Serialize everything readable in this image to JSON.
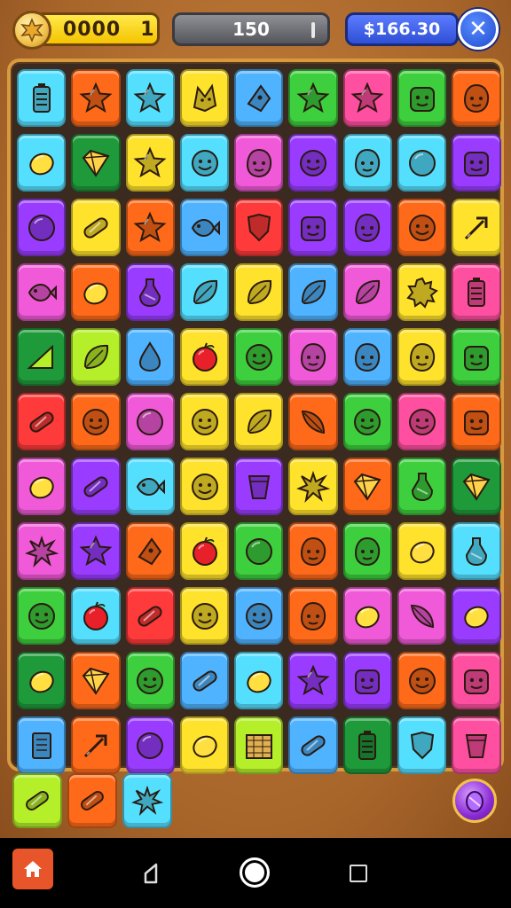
{
  "hud": {
    "coins": "0000",
    "level": "1",
    "score": "150",
    "money": "$166.30",
    "close_symbol": "✕"
  },
  "colors": {
    "blue": "#4fb3ff",
    "orange": "#ff6a1a",
    "yellow": "#ffe22b",
    "red": "#ff3a3a",
    "pink": "#ff4fa0",
    "green": "#3ecf3e",
    "purple": "#9a3cff",
    "lime": "#b4ef2a",
    "cyan": "#55dfff",
    "magenta": "#f05ad8",
    "teal": "#28c6b4",
    "darkgreen": "#1e9a3a"
  },
  "board": [
    [
      [
        "cyan",
        "battery-icon"
      ],
      [
        "orange",
        "star-icon"
      ],
      [
        "cyan",
        "star-icon"
      ],
      [
        "yellow",
        "fox-icon"
      ],
      [
        "blue",
        "cheese-icon"
      ],
      [
        "green",
        "star-icon"
      ],
      [
        "pink",
        "star-icon"
      ],
      [
        "green",
        "robot-face-icon"
      ],
      [
        "orange",
        "blob-icon"
      ]
    ],
    [
      [
        "cyan",
        "lemon-icon"
      ],
      [
        "darkgreen",
        "gem-icon"
      ],
      [
        "yellow",
        "star-icon"
      ],
      [
        "cyan",
        "smile-face-icon"
      ],
      [
        "magenta",
        "blob-icon"
      ],
      [
        "purple",
        "smile-face-icon"
      ],
      [
        "cyan",
        "blob-icon"
      ],
      [
        "cyan",
        "ball-icon"
      ],
      [
        "purple",
        "robot-face-icon"
      ]
    ],
    [
      [
        "purple",
        "ball-icon"
      ],
      [
        "yellow",
        "candy-icon"
      ],
      [
        "orange",
        "star-icon"
      ],
      [
        "blue",
        "fish-icon"
      ],
      [
        "red",
        "shield-icon"
      ],
      [
        "purple",
        "robot-face-icon"
      ],
      [
        "purple",
        "blob-icon"
      ],
      [
        "orange",
        "smile-face-icon"
      ],
      [
        "yellow",
        "arrow-icon"
      ]
    ],
    [
      [
        "magenta",
        "fish-icon"
      ],
      [
        "orange",
        "lemon-icon"
      ],
      [
        "purple",
        "potion-icon"
      ],
      [
        "cyan",
        "leaf-icon"
      ],
      [
        "yellow",
        "leaf-icon"
      ],
      [
        "blue",
        "leaf-icon"
      ],
      [
        "magenta",
        "leaf-icon"
      ],
      [
        "yellow",
        "sun-icon"
      ],
      [
        "pink",
        "battery-icon"
      ]
    ],
    [
      [
        "darkgreen",
        "triangle-icon"
      ],
      [
        "lime",
        "leaf-icon"
      ],
      [
        "blue",
        "drop-icon"
      ],
      [
        "yellow",
        "apple-icon"
      ],
      [
        "green",
        "smile-face-icon"
      ],
      [
        "magenta",
        "blob-icon"
      ],
      [
        "blue",
        "blob-icon"
      ],
      [
        "yellow",
        "blob-icon"
      ],
      [
        "green",
        "robot-face-icon"
      ]
    ],
    [
      [
        "red",
        "candy-icon"
      ],
      [
        "orange",
        "smile-face-icon"
      ],
      [
        "magenta",
        "ball-icon"
      ],
      [
        "yellow",
        "smile-face-icon"
      ],
      [
        "yellow",
        "leaf-icon"
      ],
      [
        "orange",
        "feather-icon"
      ],
      [
        "green",
        "smile-face-icon"
      ],
      [
        "pink",
        "smile-face-icon"
      ],
      [
        "orange",
        "robot-face-icon"
      ]
    ],
    [
      [
        "magenta",
        "lemon-icon"
      ],
      [
        "purple",
        "candy-icon"
      ],
      [
        "cyan",
        "fish-icon"
      ],
      [
        "yellow",
        "smile-face-icon"
      ],
      [
        "purple",
        "cup-icon"
      ],
      [
        "yellow",
        "splat-icon"
      ],
      [
        "orange",
        "gem-icon"
      ],
      [
        "green",
        "potion-icon"
      ],
      [
        "darkgreen",
        "gem-icon"
      ]
    ],
    [
      [
        "magenta",
        "splat-icon"
      ],
      [
        "purple",
        "star-icon"
      ],
      [
        "orange",
        "cheese-icon"
      ],
      [
        "yellow",
        "apple-icon"
      ],
      [
        "green",
        "ball-icon"
      ],
      [
        "orange",
        "blob-icon"
      ],
      [
        "green",
        "blob-icon"
      ],
      [
        "yellow",
        "lemon-icon"
      ],
      [
        "cyan",
        "potion-icon"
      ]
    ],
    [
      [
        "green",
        "smile-face-icon"
      ],
      [
        "cyan",
        "apple-icon"
      ],
      [
        "red",
        "candy-icon"
      ],
      [
        "yellow",
        "smile-face-icon"
      ],
      [
        "blue",
        "smile-face-icon"
      ],
      [
        "orange",
        "blob-icon"
      ],
      [
        "magenta",
        "lemon-icon"
      ],
      [
        "magenta",
        "feather-icon"
      ],
      [
        "purple",
        "lemon-icon"
      ]
    ],
    [
      [
        "darkgreen",
        "lemon-icon"
      ],
      [
        "orange",
        "gem-icon"
      ],
      [
        "green",
        "smile-face-icon"
      ],
      [
        "blue",
        "candy-icon"
      ],
      [
        "cyan",
        "lemon-icon"
      ],
      [
        "purple",
        "star-icon"
      ],
      [
        "purple",
        "robot-face-icon"
      ],
      [
        "orange",
        "smile-face-icon"
      ],
      [
        "pink",
        "robot-face-icon"
      ]
    ],
    [
      [
        "blue",
        "book-icon"
      ],
      [
        "orange",
        "arrow-icon"
      ],
      [
        "purple",
        "ball-icon"
      ],
      [
        "yellow",
        "lemon-icon"
      ],
      [
        "lime",
        "crate-icon"
      ],
      [
        "blue",
        "candy-icon"
      ],
      [
        "darkgreen",
        "battery-icon"
      ],
      [
        "cyan",
        "shield-icon"
      ],
      [
        "pink",
        "cup-icon"
      ]
    ]
  ],
  "tray": [
    [
      "lime",
      "candy-icon"
    ],
    [
      "orange",
      "candy-icon"
    ],
    [
      "cyan",
      "splat-icon"
    ]
  ],
  "powerup": "potion-icon"
}
